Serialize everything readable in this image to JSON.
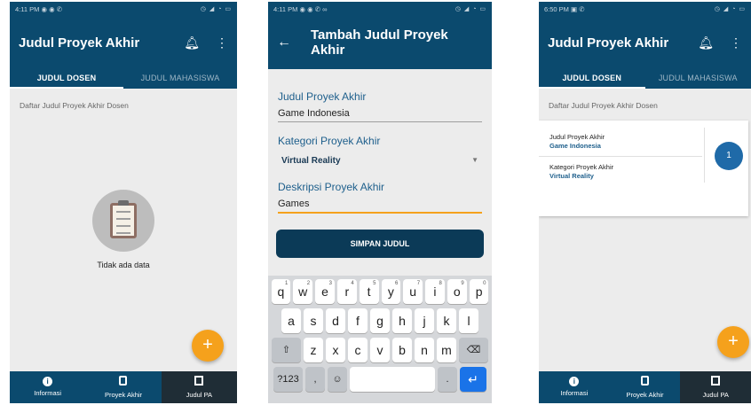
{
  "screen1": {
    "status": {
      "time": "4:11 PM",
      "left_icons": "◉ ◉ ✆",
      "right_icons": "◷ ◢ ◔ ▭"
    },
    "title": "Judul Proyek Akhir",
    "tabs": [
      "JUDUL DOSEN",
      "JUDUL MAHASISWA"
    ],
    "section_label": "Daftar Judul Proyek Akhir Dosen",
    "empty_text": "Tidak ada data",
    "fab": "+",
    "nav": [
      "Informasi",
      "Proyek Akhir",
      "Judul PA"
    ]
  },
  "screen2": {
    "status": {
      "time": "4:11 PM",
      "left_icons": "◉ ◉ ✆ ∞",
      "right_icons": "◷ ◢ ◔ ▭"
    },
    "title": "Tambah Judul Proyek Akhir",
    "fields": {
      "judul_label": "Judul Proyek Akhir",
      "judul_value": "Game Indonesia",
      "kategori_label": "Kategori Proyek Akhir",
      "kategori_value": "Virtual Reality",
      "deskripsi_label": "Deskripsi Proyek Akhir",
      "deskripsi_value": "Games"
    },
    "save_label": "SIMPAN JUDUL",
    "keyboard": {
      "row1": [
        [
          "q",
          "1"
        ],
        [
          "w",
          "2"
        ],
        [
          "e",
          "3"
        ],
        [
          "r",
          "4"
        ],
        [
          "t",
          "5"
        ],
        [
          "y",
          "6"
        ],
        [
          "u",
          "7"
        ],
        [
          "i",
          "8"
        ],
        [
          "o",
          "9"
        ],
        [
          "p",
          "0"
        ]
      ],
      "row2": [
        "a",
        "s",
        "d",
        "f",
        "g",
        "h",
        "j",
        "k",
        "l"
      ],
      "row3": [
        "⇧",
        "z",
        "x",
        "c",
        "v",
        "b",
        "n",
        "m",
        "⌫"
      ],
      "row4": [
        "?123",
        ",",
        "☺",
        "",
        ".",
        "↵"
      ]
    }
  },
  "screen3": {
    "status": {
      "time": "6:50 PM",
      "left_icons": "▣ ✆",
      "right_icons": "◷ ◢ ◔ ▭"
    },
    "title": "Judul Proyek Akhir",
    "tabs": [
      "JUDUL DOSEN",
      "JUDUL MAHASISWA"
    ],
    "section_label": "Daftar Judul Proyek Akhir Dosen",
    "card": {
      "label1": "Judul Proyek Akhir",
      "value1": "Game Indonesia",
      "label2": "Kategori Proyek Akhir",
      "value2": "Virtual Reality",
      "count": "1"
    },
    "fab": "+",
    "nav": [
      "Informasi",
      "Proyek Akhir",
      "Judul PA"
    ]
  },
  "colors": {
    "primary": "#0b4a6e",
    "accent": "#f5a11c",
    "nav_active": "#1f2d36"
  }
}
